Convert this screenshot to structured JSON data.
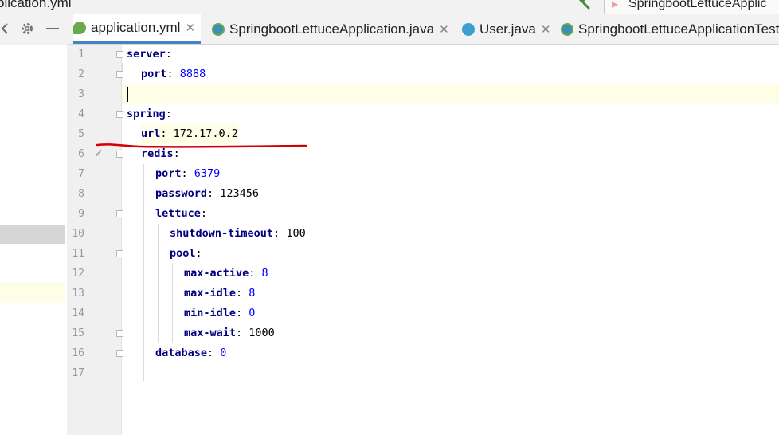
{
  "window": {
    "title_fragment": "plication.yml",
    "run_config": "SpringbootLettuceApplic"
  },
  "tabs": [
    {
      "label": "application.yml",
      "icon": "spring-yaml-icon",
      "active": true,
      "closable": true
    },
    {
      "label": "SpringbootLettuceApplication.java",
      "icon": "spring-class-icon",
      "active": false,
      "closable": true
    },
    {
      "label": "User.java",
      "icon": "class-icon",
      "active": false,
      "closable": true
    },
    {
      "label": "SpringbootLettuceApplicationTest",
      "icon": "test-class-icon",
      "active": false,
      "closable": false
    }
  ],
  "tab_close_glyph": "✕",
  "toolbar_icons": [
    "gear-icon",
    "minimize-icon"
  ],
  "editor": {
    "line_numbers": [
      "1",
      "2",
      "3",
      "4",
      "5",
      "6",
      "7",
      "8",
      "9",
      "10",
      "11",
      "12",
      "13",
      "14",
      "15",
      "16",
      "17"
    ],
    "lines": [
      {
        "key": "server",
        "sep": ":",
        "value": "",
        "vtype": ""
      },
      {
        "key": "port",
        "sep": ": ",
        "value": "8888",
        "vtype": "num"
      },
      {
        "key": "",
        "sep": "",
        "value": "",
        "vtype": ""
      },
      {
        "key": "spring",
        "sep": ":",
        "value": "",
        "vtype": ""
      },
      {
        "key": "url",
        "sep": ": ",
        "value": "172.17.0.2",
        "vtype": "str"
      },
      {
        "key": "redis",
        "sep": ":",
        "value": "",
        "vtype": ""
      },
      {
        "key": "port",
        "sep": ": ",
        "value": "6379",
        "vtype": "num"
      },
      {
        "key": "password",
        "sep": ": ",
        "value": "123456",
        "vtype": "str"
      },
      {
        "key": "lettuce",
        "sep": ":",
        "value": "",
        "vtype": ""
      },
      {
        "key": "shutdown-timeout",
        "sep": ": ",
        "value": "100",
        "vtype": "str"
      },
      {
        "key": "pool",
        "sep": ":",
        "value": "",
        "vtype": ""
      },
      {
        "key": "max-active",
        "sep": ": ",
        "value": "8",
        "vtype": "num"
      },
      {
        "key": "max-idle",
        "sep": ": ",
        "value": "8",
        "vtype": "num"
      },
      {
        "key": "min-idle",
        "sep": ": ",
        "value": "0",
        "vtype": "num"
      },
      {
        "key": "max-wait",
        "sep": ": ",
        "value": "1000",
        "vtype": "str"
      },
      {
        "key": "database",
        "sep": ": ",
        "value": "0",
        "vtype": "num"
      },
      {
        "key": "",
        "sep": "",
        "value": "",
        "vtype": ""
      }
    ],
    "checkmark_glyph": "✓",
    "colors": {
      "key": "#000080",
      "number": "#0000ff",
      "annotation": "#d40000",
      "current_line": "#fefde5",
      "tab_underline": "#4083c9"
    }
  }
}
